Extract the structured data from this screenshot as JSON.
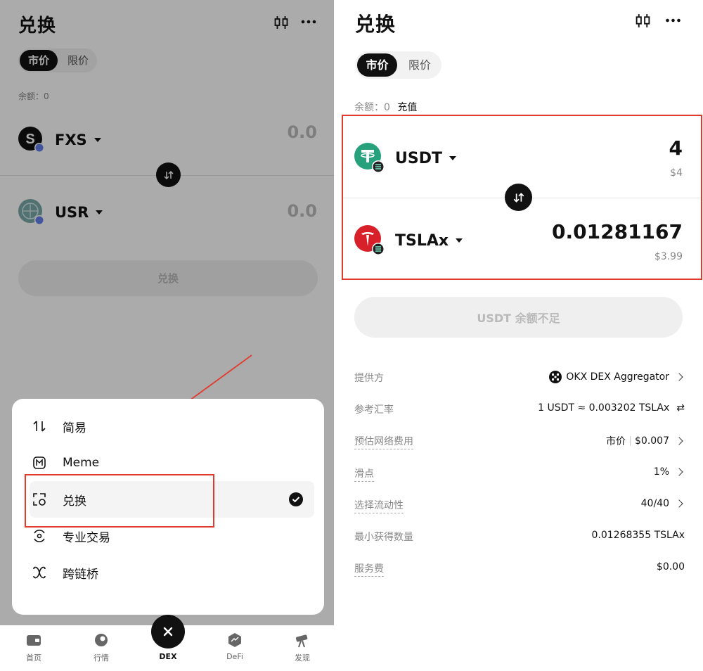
{
  "left": {
    "title": "兑换",
    "tabs": {
      "market": "市价",
      "limit": "限价"
    },
    "balance": "余额：0",
    "from_token": {
      "symbol": "FXS",
      "amount": "0.0"
    },
    "to_token": {
      "symbol": "USR",
      "amount": "0.0"
    },
    "swap_button": "兑换",
    "menu": {
      "items": [
        {
          "label": "简易",
          "icon": "sort-icon"
        },
        {
          "label": "Meme",
          "icon": "meme-icon"
        },
        {
          "label": "兑换",
          "icon": "swap-grid-icon",
          "selected": true
        },
        {
          "label": "专业交易",
          "icon": "pro-trade-icon"
        },
        {
          "label": "跨链桥",
          "icon": "bridge-icon"
        }
      ]
    },
    "bottom_nav": [
      {
        "label": "首页",
        "icon": "wallet-icon"
      },
      {
        "label": "行情",
        "icon": "market-icon"
      },
      {
        "label": "DEX",
        "icon": "close-icon"
      },
      {
        "label": "DeFi",
        "icon": "defi-icon"
      },
      {
        "label": "发现",
        "icon": "telescope-icon"
      }
    ]
  },
  "right": {
    "title": "兑换",
    "tabs": {
      "market": "市价",
      "limit": "限价"
    },
    "balance_label": "余额：0",
    "recharge": "充值",
    "from_token": {
      "symbol": "USDT",
      "amount": "4",
      "usd": "$4"
    },
    "to_token": {
      "symbol": "TSLAx",
      "amount": "0.01281167",
      "usd": "$3.99"
    },
    "action_button": "USDT 余额不足",
    "details": {
      "provider_label": "提供方",
      "provider_value": "OKX DEX Aggregator",
      "rate_label": "参考汇率",
      "rate_value": "1 USDT ≈ 0.003202 TSLAx",
      "fee_label": "预估网络费用",
      "fee_mode": "市价",
      "fee_value": "$0.007",
      "slippage_label": "滑点",
      "slippage_value": "1%",
      "liquidity_label": "选择流动性",
      "liquidity_value": "40/40",
      "min_receive_label": "最小获得数量",
      "min_receive_value": "0.01268355 TSLAx",
      "service_fee_label": "服务费",
      "service_fee_value": "$0.00"
    }
  },
  "colors": {
    "accent": "#111111",
    "highlight_red": "#e23b2e",
    "usdt": "#26a17b",
    "tesla": "#d8202a"
  }
}
